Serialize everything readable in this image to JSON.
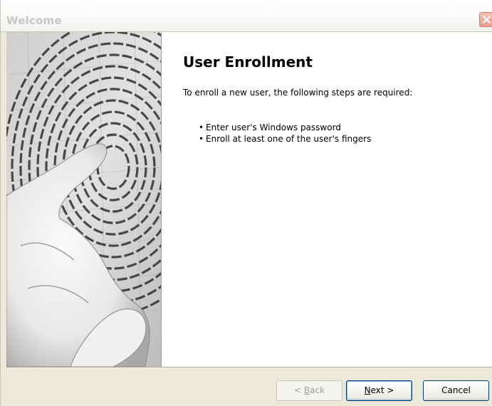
{
  "window": {
    "title": "Welcome"
  },
  "content": {
    "heading": "User Enrollment",
    "intro": "To enroll a new user, the following steps are required:",
    "steps": [
      "Enter user's Windows password",
      "Enroll at least one of the user's fingers"
    ]
  },
  "buttons": {
    "back_accel": "B",
    "back_rest": "ack",
    "back_prefix": "< ",
    "next_accel": "N",
    "next_rest": "ext >",
    "cancel": "Cancel"
  },
  "icons": {
    "close": "close-icon",
    "fingerprint": "fingerprint-hand-image"
  }
}
